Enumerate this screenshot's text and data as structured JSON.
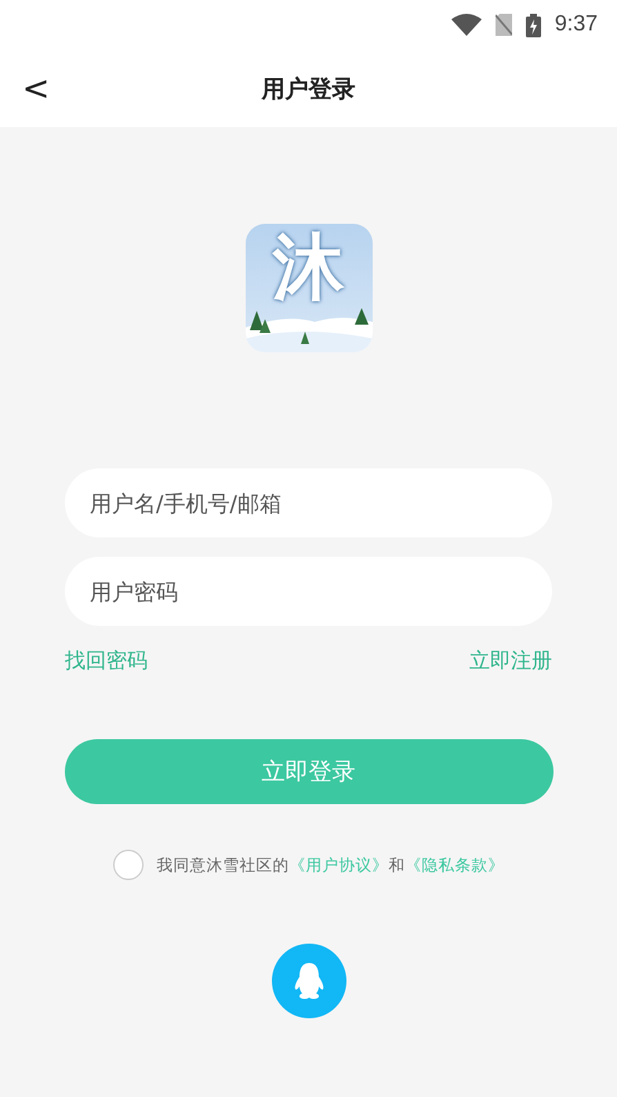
{
  "status_bar": {
    "time": "9:37"
  },
  "header": {
    "back": "<",
    "title": "用户登录"
  },
  "logo": {
    "character": "沐"
  },
  "fields": [
    {
      "placeholder": "用户名/手机号/邮箱"
    },
    {
      "placeholder": "用户密码"
    }
  ],
  "links": {
    "forgot": "找回密码",
    "register": "立即注册"
  },
  "login_button": "立即登录",
  "agreement": {
    "checked": false,
    "text": "我同意沐雪社区的",
    "terms": "《用户协议》",
    "and": "和",
    "privacy": "《隐私条款》"
  }
}
